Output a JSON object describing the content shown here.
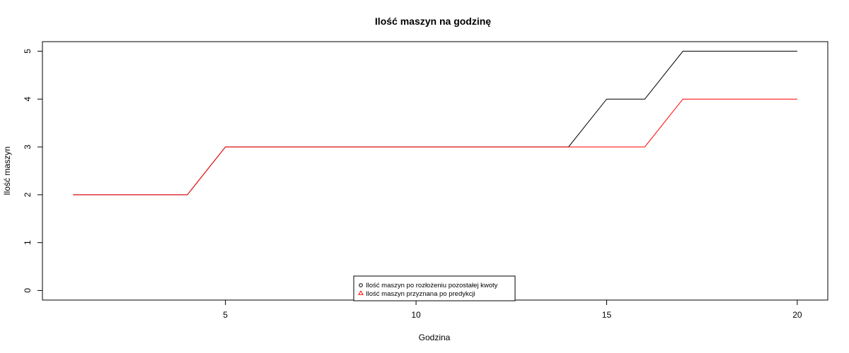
{
  "chart_data": {
    "type": "line",
    "title": "Ilość maszyn na godzinę",
    "xlabel": "Godzina",
    "ylabel": "Ilość maszyn",
    "xlim": [
      0.2,
      20.8
    ],
    "ylim": [
      -0.2,
      5.2
    ],
    "x_ticks": [
      5,
      10,
      15,
      20
    ],
    "y_ticks": [
      0,
      1,
      2,
      3,
      4,
      5
    ],
    "x": [
      1,
      2,
      3,
      4,
      5,
      6,
      7,
      8,
      9,
      10,
      11,
      12,
      13,
      14,
      15,
      16,
      17,
      18,
      19,
      20
    ],
    "series": [
      {
        "name": "Ilość maszyn po rozłożeniu pozostałej kwoty",
        "color": "#000000",
        "marker": "circle",
        "values": [
          2,
          2,
          2,
          2,
          3,
          3,
          3,
          3,
          3,
          3,
          3,
          3,
          3,
          3,
          4,
          4,
          5,
          5,
          5,
          5
        ]
      },
      {
        "name": "Ilość maszyn przyznana po predykcji",
        "color": "#ff0000",
        "marker": "triangle",
        "values": [
          2,
          2,
          2,
          2,
          3,
          3,
          3,
          3,
          3,
          3,
          3,
          3,
          3,
          3,
          3,
          3,
          4,
          4,
          4,
          4
        ]
      }
    ],
    "grid": false,
    "legend_position": "bottom-center"
  }
}
